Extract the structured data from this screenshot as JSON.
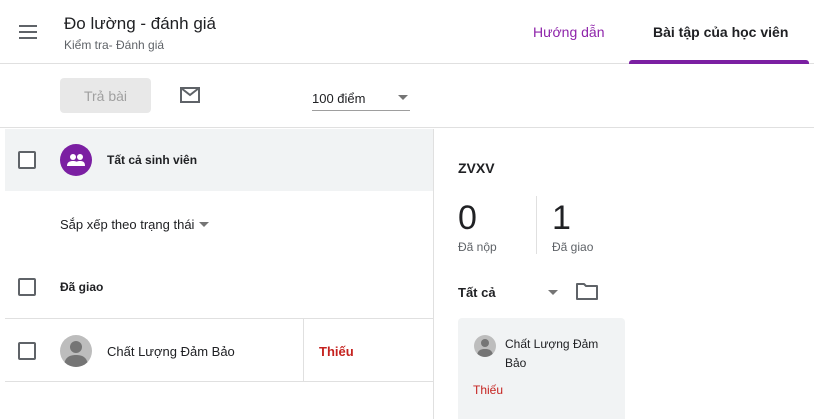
{
  "header": {
    "title": "Đo lường - đánh giá",
    "subtitle": "Kiểm tra- Đánh giá",
    "tabs": [
      {
        "label": "Hướng dẫn",
        "active": false
      },
      {
        "label": "Bài tập của học viên",
        "active": true
      }
    ]
  },
  "toolbar": {
    "return_label": "Trả bài",
    "points_value": "100 điểm"
  },
  "left": {
    "all_students_label": "Tất cả sinh viên",
    "sort_label": "Sắp xếp theo trạng thái",
    "assigned_label": "Đã giao",
    "students": [
      {
        "name": "Chất Lượng Đảm Bảo",
        "status": "Thiếu"
      }
    ]
  },
  "right": {
    "assignment_title": "ZVXV",
    "stats": [
      {
        "value": "0",
        "label": "Đã nộp"
      },
      {
        "value": "1",
        "label": "Đã giao"
      }
    ],
    "filter_label": "Tất cả",
    "cards": [
      {
        "name": "Chất Lượng Đảm Bảo",
        "status": "Thiếu"
      }
    ]
  },
  "colors": {
    "accent": "#7b1fa2",
    "missing": "#c5221f"
  },
  "icons": [
    "menu-icon",
    "mail-icon",
    "group-icon",
    "person-icon",
    "folder-icon",
    "caret-down-icon"
  ]
}
